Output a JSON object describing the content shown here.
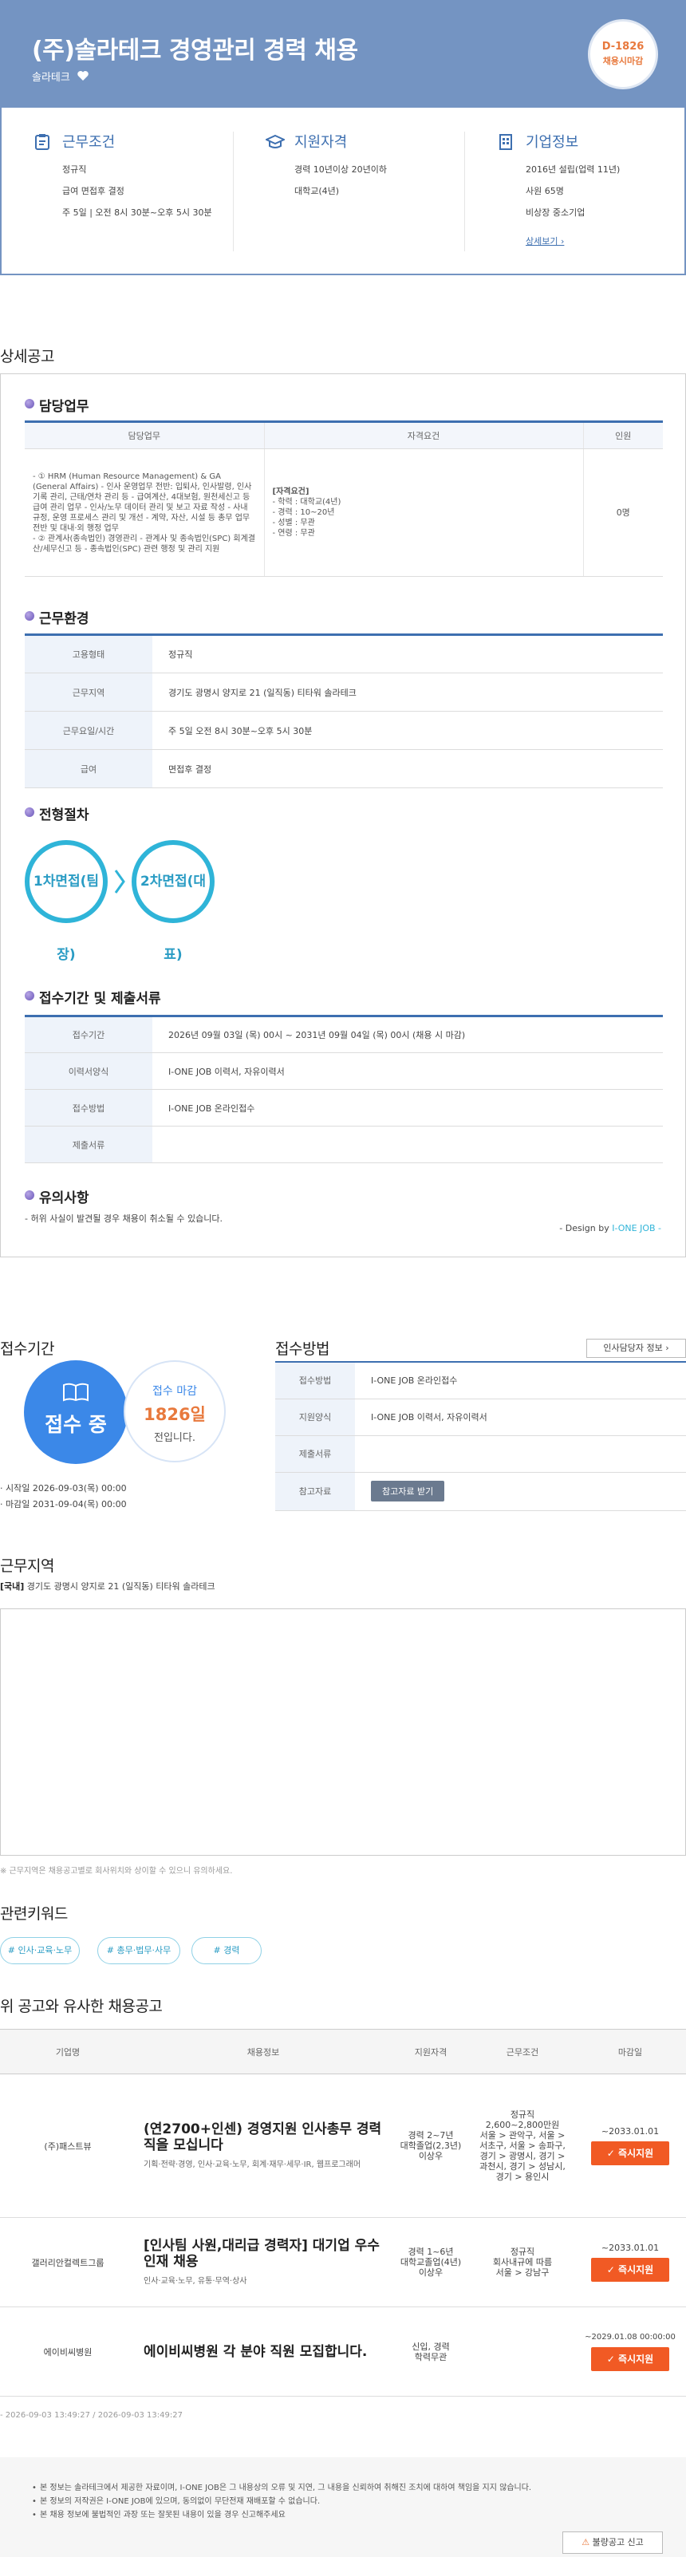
{
  "header": {
    "title": "(주)솔라테크 경영관리 경력 채용",
    "company": "솔라테크",
    "dday": "D-1826",
    "dday_label": "채용시마감"
  },
  "summary": {
    "conditions": {
      "title": "근무조건",
      "lines": [
        "정규직",
        "급여 면접후 결정",
        "주 5일 | 오전 8시 30분~오후 5시 30분"
      ]
    },
    "qualification": {
      "title": "지원자격",
      "lines": [
        "경력 10년이상 20년이하",
        "대학교(4년)"
      ]
    },
    "company_info": {
      "title": "기업정보",
      "lines": [
        "2016년 설립(업력 11년)",
        "사원 65명",
        "비상장 중소기업"
      ],
      "more_link": "상세보기 ›"
    }
  },
  "detail": {
    "section_title": "상세공고",
    "duty": {
      "title": "담당업무",
      "headers": [
        "담당업무",
        "자격요건",
        "인원"
      ],
      "task": "- ① HRM (Human Resource Management) & GA (General Affairs) - 인사 운영업무 전반: 입퇴사, 인사발령, 인사기록 관리, 근태/연차 관리 등 - 급여계산, 4대보험, 원천세신고 등 급여 관리 업무 - 인사/노무 데이터 관리 및 보고 자료 작성 - 사내 규정, 운영 프로세스 관리 및 개선 - 계약, 자산, 시설 등 총무 업무 전반 및 대내·외 행정 업무\n- ② 관계사(종속법인) 경영관리 - 관계사 및 종속법인(SPC) 회계결산/세무신고 등 - 종속법인(SPC) 관련 행정 및 관리 지원",
      "req_title": "[자격요건]",
      "req_lines": [
        "- 학력 : 대학교(4년)",
        "- 경력 : 10~20년",
        "- 성별 : 무관",
        "- 연령 : 무관"
      ],
      "headcount": "0명"
    },
    "environment": {
      "title": "근무환경",
      "rows": [
        {
          "label": "고용형태",
          "value": "정규직"
        },
        {
          "label": "근무지역",
          "value": "경기도 광명시 양지로 21 (일직동) 티타워 솔라테크"
        },
        {
          "label": "근무요일/시간",
          "value": "주 5일 오전 8시 30분~오후 5시 30분"
        },
        {
          "label": "급여",
          "value": "면접후 결정"
        }
      ]
    },
    "process": {
      "title": "전형절차",
      "steps": [
        "1차면접(팀장)",
        "2차면접(대표)"
      ]
    },
    "submission": {
      "title": "접수기간 및 제출서류",
      "rows": [
        {
          "label": "접수기간",
          "value": "2026년 09월 03일 (목) 00시 ~ 2031년 09월 04일 (목) 00시 (채용 시 마감)"
        },
        {
          "label": "이력서양식",
          "value": "I-ONE JOB 이력서, 자유이력서"
        },
        {
          "label": "접수방법",
          "value": "I-ONE JOB 온라인접수"
        },
        {
          "label": "제출서류",
          "value": ""
        }
      ]
    },
    "notes": {
      "title": "유의사항",
      "text": "- 허위 사실이 발견될 경우 채용이 취소될 수 있습니다.",
      "design_prefix": "- Design by ",
      "design_brand": "I-ONE JOB -"
    }
  },
  "apply": {
    "period_title": "접수기간",
    "status": "접수 중",
    "deadline_label": "접수 마감",
    "deadline_days": "1826일",
    "deadline_suffix": "전입니다.",
    "start": "· 시작일 2026-09-03(목) 00:00",
    "end": "· 마감일 2031-09-04(목) 00:00",
    "method_title": "접수방법",
    "manager_button": "인사담당자 정보 ›",
    "rows": [
      {
        "label": "접수방법",
        "value": "I-ONE JOB 온라인접수"
      },
      {
        "label": "지원양식",
        "value": "I-ONE JOB 이력서, 자유이력서"
      },
      {
        "label": "제출서류",
        "value": ""
      },
      {
        "label": "참고자료",
        "value": ""
      }
    ],
    "ref_button": "참고자료 받기"
  },
  "location": {
    "title": "근무지역",
    "tag": "[국내]",
    "address": " 경기도 광명시 양지로 21 (일직동) 티타워 솔라테크",
    "note": "※ 근무지역은 채용공고별로 회사위치와 상이할 수 있으니 유의하세요."
  },
  "keywords": {
    "title": "관련키워드",
    "items": [
      "# 인사·교육·노무",
      "# 총무·법무·사무",
      "# 경력"
    ]
  },
  "similar": {
    "title": "위 공고와 유사한 채용공고",
    "headers": [
      "기업명",
      "채용정보",
      "지원자격",
      "근무조건",
      "마감일"
    ],
    "rows": [
      {
        "company": "(주)패스트뷰",
        "title": "(연2700+인센) 경영지원 인사총무 경력직을 모십니다",
        "sub": "기획·전략·경영, 인사·교육·노무, 회계·재무·세무·IR, 웹프로그래머",
        "qual": "경력 2~7년\n대학졸업(2,3년)\n이상우",
        "cond": "정규직\n2,600~2,800만원\n서울 > 관악구, 서울 > 서초구, 서울 > 송파구, 경기 > 광명시, 경기 > 과천시, 경기 > 성남시, 경기 > 용인시",
        "deadline": "~2033.01.01",
        "apply": "✓ 즉시지원"
      },
      {
        "company": "갤러리안컬렉트그룹",
        "title": "[인사팀 사원,대리급 경력자] 대기업 우수인재 채용",
        "sub": "인사·교육·노무, 유통·무역·상사",
        "qual": "경력 1~6년\n대학교졸업(4년)\n이상우",
        "cond": "정규직\n회사내규에 따름\n서울 > 강남구",
        "deadline": "~2033.01.01",
        "apply": "✓ 즉시지원"
      },
      {
        "company": "에이비씨병원",
        "title": "에이비씨병원 각 분야 직원 모집합니다.",
        "sub": "",
        "qual": "신입, 경력\n학력무관",
        "cond": "",
        "deadline": "~2029.01.08 00:00:00",
        "apply": "✓ 즉시지원"
      }
    ]
  },
  "footer": {
    "dates": "- 2026-09-03 13:49:27 / 2026-09-03 13:49:27",
    "notes": [
      "본 정보는 솔라테크에서 제공한 자료이며, I-ONE JOB은 그 내용상의 오류 및 지연, 그 내용을 신뢰하여 취해진 조치에 대하여 책임을 지지 않습니다.",
      "본 정보의 저작권은 I-ONE JOB에 있으며, 동의없이 무단전재 재배포할 수 없습니다.",
      "본 채용 정보에 불법적인 과장 또는 잘못된 내용이 있을 경우 신고해주세요"
    ],
    "report_button": "불량공고 신고"
  }
}
